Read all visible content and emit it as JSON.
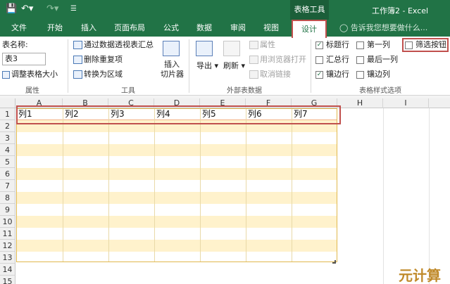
{
  "titlebar": {
    "save_icon": "save-icon",
    "undo_icon": "undo-icon",
    "redo_icon": "redo-icon",
    "customize_icon": "customize-qat-icon",
    "context_tab_group": "表格工具",
    "window_title": "工作簿2 - Excel"
  },
  "tabs": [
    "文件",
    "开始",
    "插入",
    "页面布局",
    "公式",
    "数据",
    "审阅",
    "视图",
    "设计"
  ],
  "active_tab": "设计",
  "tell_me": "告诉我您想要做什么...",
  "ribbon": {
    "properties": {
      "table_name_label": "表名称:",
      "table_name_value": "表3",
      "resize_button": "调整表格大小",
      "group_label": "属性"
    },
    "tools": {
      "summarize_pivot": "通过数据透视表汇总",
      "remove_duplicates": "删除重复项",
      "convert_to_range": "转换为区域",
      "insert_slicer_line1": "插入",
      "insert_slicer_line2": "切片器",
      "group_label": "工具"
    },
    "external": {
      "export": "导出",
      "refresh": "刷新",
      "properties": "属性",
      "open_in_browser": "用浏览器打开",
      "unlink": "取消链接",
      "group_label": "外部表数据"
    },
    "style_options": {
      "header_row": "标题行",
      "first_column": "第一列",
      "filter_button": "筛选按钮",
      "total_row": "汇总行",
      "last_column": "最后一列",
      "banded_rows": "镶边行",
      "banded_columns": "镶边列",
      "group_label": "表格样式选项",
      "header_row_checked": true,
      "first_column_checked": false,
      "filter_button_checked": false,
      "total_row_checked": false,
      "last_column_checked": false,
      "banded_rows_checked": true,
      "banded_columns_checked": false
    }
  },
  "grid": {
    "columns": [
      "A",
      "B",
      "C",
      "D",
      "E",
      "F",
      "G",
      "H",
      "I"
    ],
    "rows": [
      "1",
      "2",
      "3",
      "4",
      "5",
      "6",
      "7",
      "8",
      "9",
      "10",
      "11",
      "12",
      "13",
      "14",
      "15"
    ],
    "header_cells": [
      "列1",
      "列2",
      "列3",
      "列4",
      "列5",
      "列6",
      "列7"
    ]
  },
  "watermark": "元计算",
  "colors": {
    "excel_green": "#217346",
    "band_yellow": "#fff2cc",
    "highlight_red": "#c0504d"
  }
}
